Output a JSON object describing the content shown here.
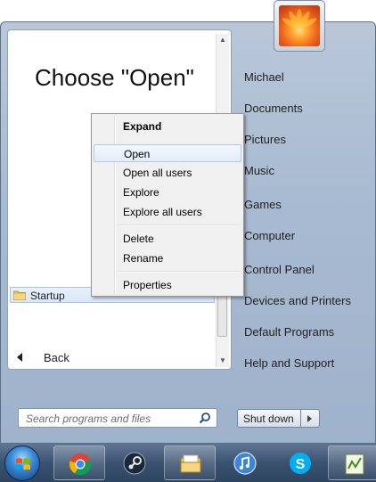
{
  "left_pane": {
    "overlay_text": "Choose \"Open\"",
    "startup_folder": "Startup",
    "back_label": "Back",
    "search_placeholder": "Search programs and files"
  },
  "context_menu": {
    "items": [
      {
        "label": "Expand",
        "bold": true
      },
      {
        "label": "Open",
        "highlighted": true
      },
      {
        "label": "Open all users"
      },
      {
        "label": "Explore"
      },
      {
        "label": "Explore all users"
      },
      {
        "label": "Delete"
      },
      {
        "label": "Rename"
      },
      {
        "label": "Properties"
      }
    ]
  },
  "right_pane": {
    "links": [
      "Michael",
      "Documents",
      "Pictures",
      "Music",
      "Games",
      "Computer",
      "Control Panel",
      "Devices and Printers",
      "Default Programs",
      "Help and Support"
    ],
    "shutdown_label": "Shut down"
  },
  "taskbar": {
    "apps": [
      "chrome-icon",
      "steam-icon",
      "explorer-icon",
      "itunes-icon",
      "skype-icon",
      "audio-app-icon"
    ]
  },
  "colors": {
    "highlight_border": "#aecbed",
    "taskbar": "#3a5270",
    "menu_frame": "#a9bbd2"
  }
}
